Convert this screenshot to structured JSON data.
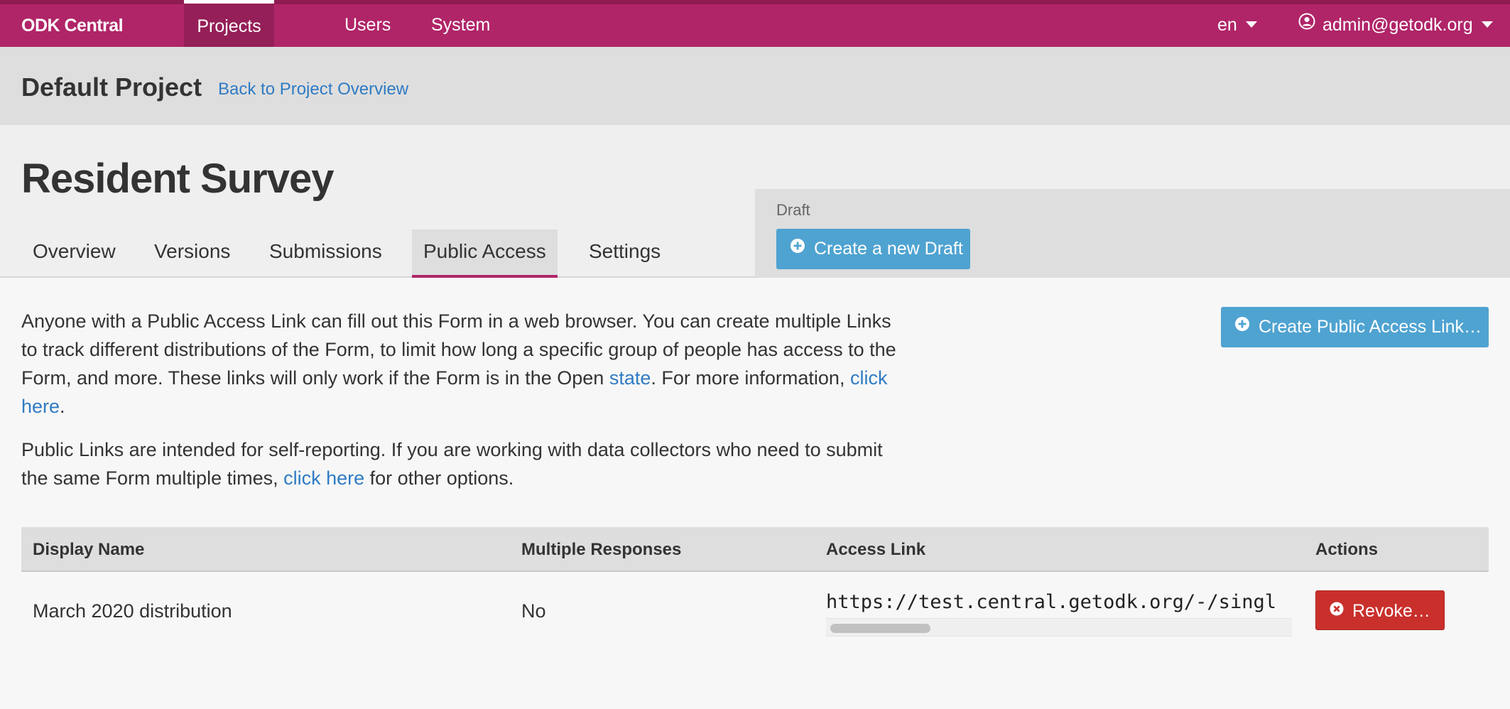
{
  "navbar": {
    "brand": "ODK Central",
    "items": [
      {
        "label": "Projects"
      },
      {
        "label": "Users"
      },
      {
        "label": "System"
      }
    ],
    "language": "en",
    "user": "admin@getodk.org",
    "colors": {
      "background": "#b02568",
      "active": "#951f58"
    }
  },
  "project": {
    "title": "Default Project",
    "back_link": "Back to Project Overview"
  },
  "form": {
    "title": "Resident Survey",
    "tabs": [
      {
        "label": "Overview"
      },
      {
        "label": "Versions"
      },
      {
        "label": "Submissions"
      },
      {
        "label": "Public Access",
        "active": true
      },
      {
        "label": "Settings"
      }
    ],
    "draft": {
      "label": "Draft",
      "button": "Create a new Draft"
    }
  },
  "content": {
    "desc1": {
      "text": "Anyone with a Public Access Link can fill out this Form in a web browser. You can create multiple Links to track different distributions of the Form, to limit how long a specific group of people has access to the Form, and more. These links will only work if the Form is in the Open ",
      "link_state": "state",
      "text_mid": ". For more information, ",
      "link_click": "click here",
      "text_end": "."
    },
    "desc2": {
      "text": "Public Links are intended for self-reporting. If you are working with data collectors who need to submit the same Form multiple times, ",
      "link_click": "click here",
      "text_end": " for other options."
    },
    "create_button": "Create Public Access Link…"
  },
  "table": {
    "headers": [
      "Display Name",
      "Multiple Responses",
      "Access Link",
      "Actions"
    ],
    "rows": [
      {
        "display_name": "March 2020 distribution",
        "multiple_responses": "No",
        "access_link": "https://test.central.getodk.org/-/singl",
        "action": "Revoke…"
      }
    ]
  }
}
